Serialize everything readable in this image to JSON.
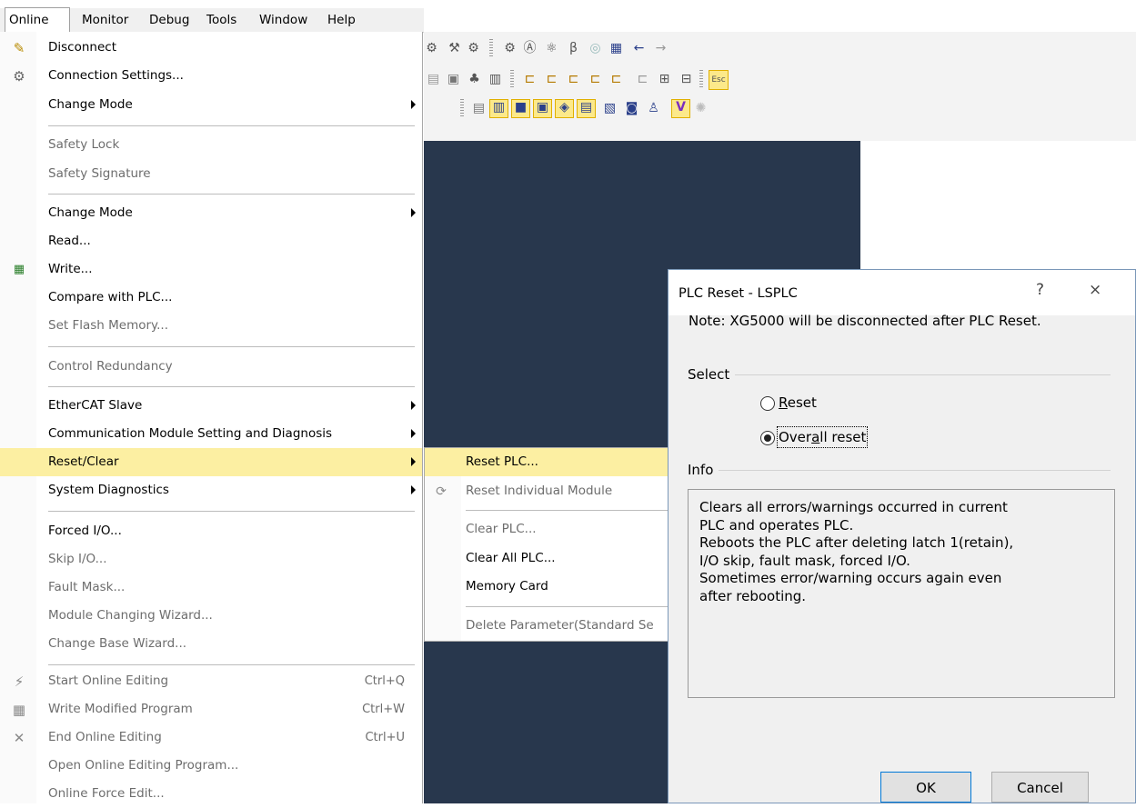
{
  "menubar": {
    "items": [
      "Online",
      "Monitor",
      "Debug",
      "Tools",
      "Window",
      "Help"
    ]
  },
  "online_menu": {
    "items": [
      {
        "label": "Disconnect",
        "icon": "disconnect-icon"
      },
      {
        "label": "Connection Settings...",
        "icon": "connection-settings-icon"
      },
      {
        "label": "Change Mode",
        "submenu": true
      },
      {
        "label": "Safety Lock",
        "disabled": true
      },
      {
        "label": "Safety Signature",
        "disabled": true
      },
      {
        "label": "Change Mode",
        "submenu": true
      },
      {
        "label": "Read..."
      },
      {
        "label": "Write...",
        "icon": "write-icon"
      },
      {
        "label": "Compare with PLC..."
      },
      {
        "label": "Set Flash Memory...",
        "disabled": true
      },
      {
        "label": "Control Redundancy",
        "disabled": true
      },
      {
        "label": "EtherCAT Slave",
        "submenu": true
      },
      {
        "label": "Communication Module Setting and Diagnosis",
        "submenu": true
      },
      {
        "label": "Reset/Clear",
        "submenu": true,
        "highlighted": true
      },
      {
        "label": "System Diagnostics",
        "submenu": true
      },
      {
        "label": "Forced I/O..."
      },
      {
        "label": "Skip I/O...",
        "disabled": true
      },
      {
        "label": "Fault Mask...",
        "disabled": true
      },
      {
        "label": "Module Changing Wizard...",
        "disabled": true
      },
      {
        "label": "Change Base Wizard...",
        "disabled": true
      },
      {
        "label": "Start Online Editing",
        "shortcut": "Ctrl+Q",
        "disabled": true,
        "icon": "start-online-editing-icon"
      },
      {
        "label": "Write Modified Program",
        "shortcut": "Ctrl+W",
        "disabled": true,
        "icon": "write-modified-program-icon"
      },
      {
        "label": "End Online Editing",
        "shortcut": "Ctrl+U",
        "disabled": true,
        "icon": "end-online-editing-icon"
      },
      {
        "label": "Open Online Editing Program...",
        "disabled": true
      },
      {
        "label": "Online Force Edit...",
        "disabled": true
      }
    ]
  },
  "reset_clear_submenu": {
    "items": [
      {
        "label": "Reset PLC...",
        "highlighted": true
      },
      {
        "label": "Reset Individual Module",
        "disabled": true,
        "icon": "reset-module-icon"
      },
      {
        "label": "Clear PLC...",
        "disabled": true
      },
      {
        "label": "Clear All PLC..."
      },
      {
        "label": "Memory Card"
      },
      {
        "label": "Delete Parameter(Standard Se",
        "disabled": true
      }
    ]
  },
  "dialog": {
    "title": "PLC Reset - LSPLC",
    "help": "?",
    "close": "×",
    "note": "Note: XG5000 will be disconnected after PLC Reset.",
    "select_label": "Select",
    "options": [
      {
        "label_pre": "",
        "label_key": "R",
        "label_post": "eset",
        "selected": false
      },
      {
        "label_pre": "Over",
        "label_key": "a",
        "label_post": "ll reset",
        "selected": true
      }
    ],
    "info_label": "Info",
    "info_text": "Clears all errors/warnings occurred in current\nPLC and operates PLC.\nReboots the PLC after deleting latch 1(retain),\nI/O skip, fault mask, forced I/O.\nSometimes error/warning occurs again even\nafter rebooting.",
    "ok": "OK",
    "cancel": "Cancel"
  }
}
